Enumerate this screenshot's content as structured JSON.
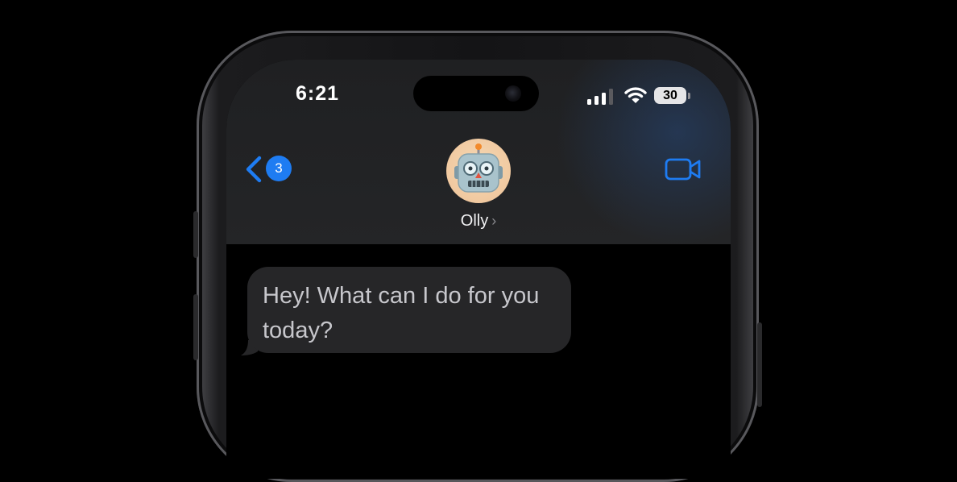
{
  "status_bar": {
    "time": "6:21",
    "battery_level": "30",
    "signal_strength_bars": 3,
    "signal_total_bars": 4
  },
  "nav": {
    "back_badge_count": "3",
    "contact_name": "Olly",
    "contact_chevron": "›",
    "avatar_icon": "robot-emoji-icon",
    "video_icon": "video-camera-icon"
  },
  "messages": [
    {
      "from": "contact",
      "text": "Hey! What can I do for you today?"
    }
  ],
  "colors": {
    "accent": "#1e7cf2",
    "bubble": "#262628",
    "header": "#232426",
    "background": "#000000"
  }
}
